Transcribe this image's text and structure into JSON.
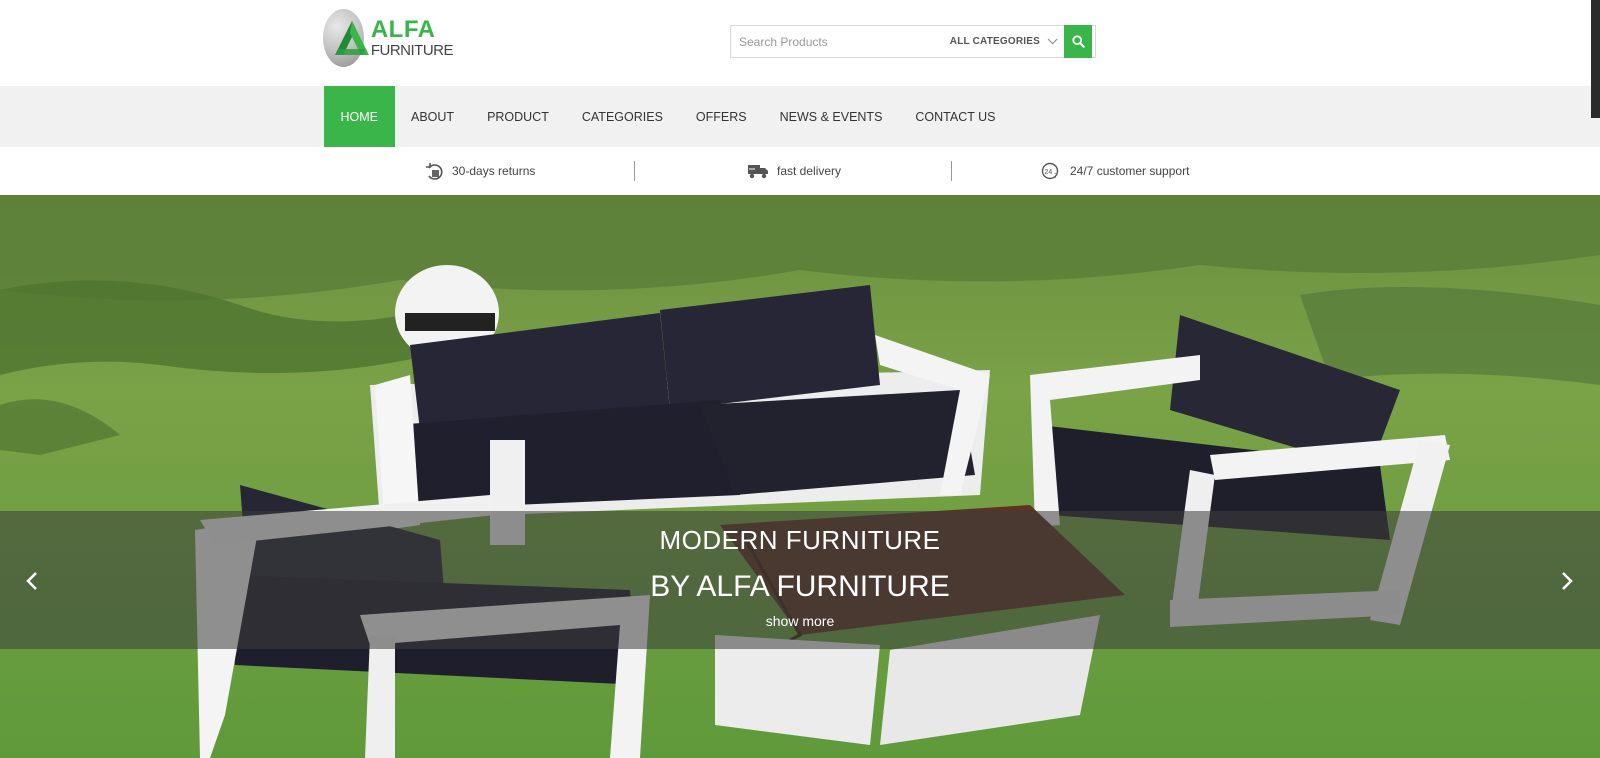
{
  "brand": {
    "name": "ALFA",
    "tagline": "FURNITURE",
    "accent_color": "#3ab54a"
  },
  "search": {
    "placeholder": "Search Products",
    "category": "ALL CATEGORIES",
    "button_icon": "search-icon"
  },
  "nav": {
    "items": [
      {
        "label": "HOME",
        "active": true
      },
      {
        "label": "ABOUT"
      },
      {
        "label": "PRODUCT"
      },
      {
        "label": "CATEGORIES"
      },
      {
        "label": "OFFERS"
      },
      {
        "label": "NEWS & EVENTS"
      },
      {
        "label": "CONTACT US"
      }
    ]
  },
  "features": [
    {
      "icon": "returns-icon",
      "label": "30-days returns"
    },
    {
      "icon": "delivery-truck-icon",
      "label": "fast delivery"
    },
    {
      "icon": "support-24-7-icon",
      "label": "24/7 customer support"
    }
  ],
  "hero": {
    "line1": "MODERN FURNITURE",
    "line2": "BY ALFA FURNITURE",
    "link": "show more",
    "prev_icon": "chevron-left-icon",
    "next_icon": "chevron-right-icon"
  }
}
